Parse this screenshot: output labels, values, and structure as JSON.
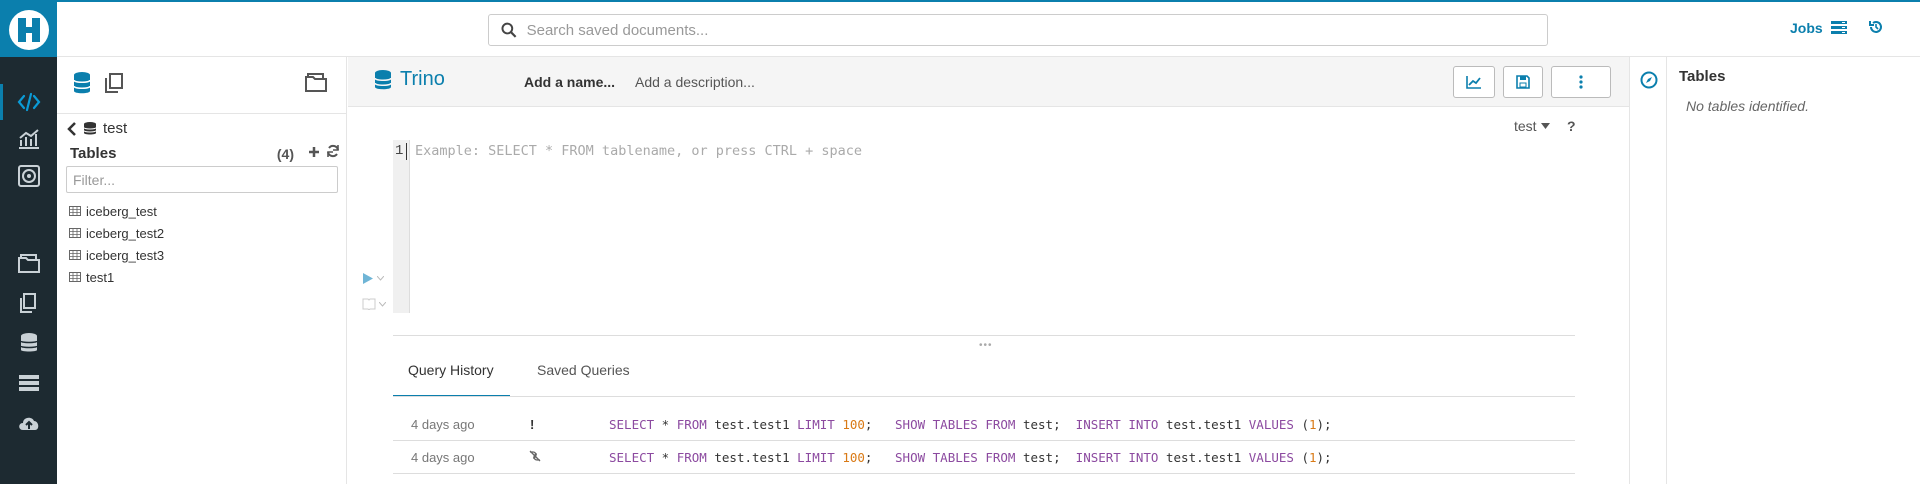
{
  "header": {
    "search_placeholder": "Search saved documents...",
    "jobs_label": "Jobs"
  },
  "assist": {
    "database": "test",
    "tables_title": "Tables",
    "tables_count": "(4)",
    "filter_placeholder": "Filter...",
    "tables": [
      "iceberg_test",
      "iceberg_test2",
      "iceberg_test3",
      "test1"
    ]
  },
  "editor": {
    "engine": "Trino",
    "name_placeholder": "Add a name...",
    "description_placeholder": "Add a description...",
    "context_db": "test",
    "help": "?",
    "line_number": "1",
    "code_placeholder": "Example: SELECT * FROM tablename, or press CTRL + space"
  },
  "tabs": [
    "Query History",
    "Saved Queries"
  ],
  "history": [
    {
      "time": "4 days ago",
      "status": "!",
      "status_icon": "error-icon"
    },
    {
      "time": "4 days ago",
      "status": "",
      "status_icon": "link-icon"
    }
  ],
  "query_parts": {
    "select": "SELECT",
    "star": " * ",
    "from": "FROM",
    "t1": " test.test1 ",
    "limit": "LIMIT",
    "limit_n": "100",
    "semi": ";",
    "show": "SHOW",
    "tables_kw": "TABLES",
    "from2": "FROM",
    "db": " test;",
    "insert": "INSERT",
    "into": "INTO",
    "t2": " test.test1 ",
    "values": "VALUES",
    "val_open": " (",
    "val_n": "1",
    "val_close": ");"
  },
  "right_assist": {
    "title": "Tables",
    "empty": "No tables identified."
  },
  "colors": {
    "accent": "#0b7fad",
    "rail": "#1d2a31",
    "keyword": "#8c4aa0",
    "number": "#d97a16"
  }
}
